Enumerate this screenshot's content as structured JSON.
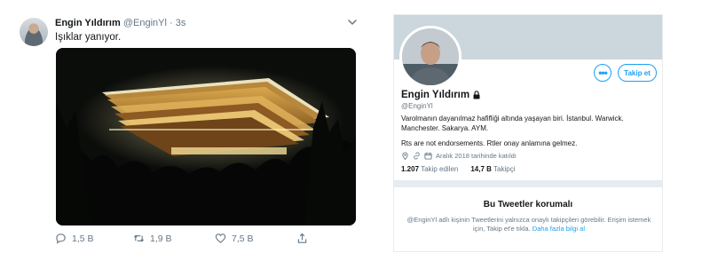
{
  "tweet": {
    "author_name": "Engin Yıldırım",
    "author_handle": "@EnginYl",
    "separator": "·",
    "time": "3s",
    "text": "Işıklar yanıyor.",
    "actions": {
      "reply_count": "1,5 B",
      "retweet_count": "1,9 B",
      "like_count": "7,5 B"
    }
  },
  "profile": {
    "name": "Engin Yıldırım",
    "handle": "@EnginYl",
    "bio": "Varolmanın dayanılmaz hafifliği altında yaşayan biri. İstanbul. Warwick. Manchester. Sakarya. AYM.",
    "bio_note": "Rts are not endorsements. Rtler onay anlamına gelmez.",
    "joined": "Aralık 2018 tarihinde katıldı",
    "following_count": "1.207",
    "following_label": "Takip edilen",
    "followers_count": "14,7 B",
    "followers_label": "Takipçi",
    "more_label": "•••",
    "follow_label": "Takip et",
    "protected_title": "Bu Tweetler korumalı",
    "protected_text": "@EnginYl adlı kişinin Tweetlerini yalnızca onaylı takipçileri görebilir. Erişim istemek için, Takip et'e tıkla.",
    "learn_more": "Daha fazla bilgi al"
  },
  "colors": {
    "accent": "#1da1f2",
    "muted": "#657786",
    "text": "#14171a",
    "banner": "#ccd6dd"
  }
}
